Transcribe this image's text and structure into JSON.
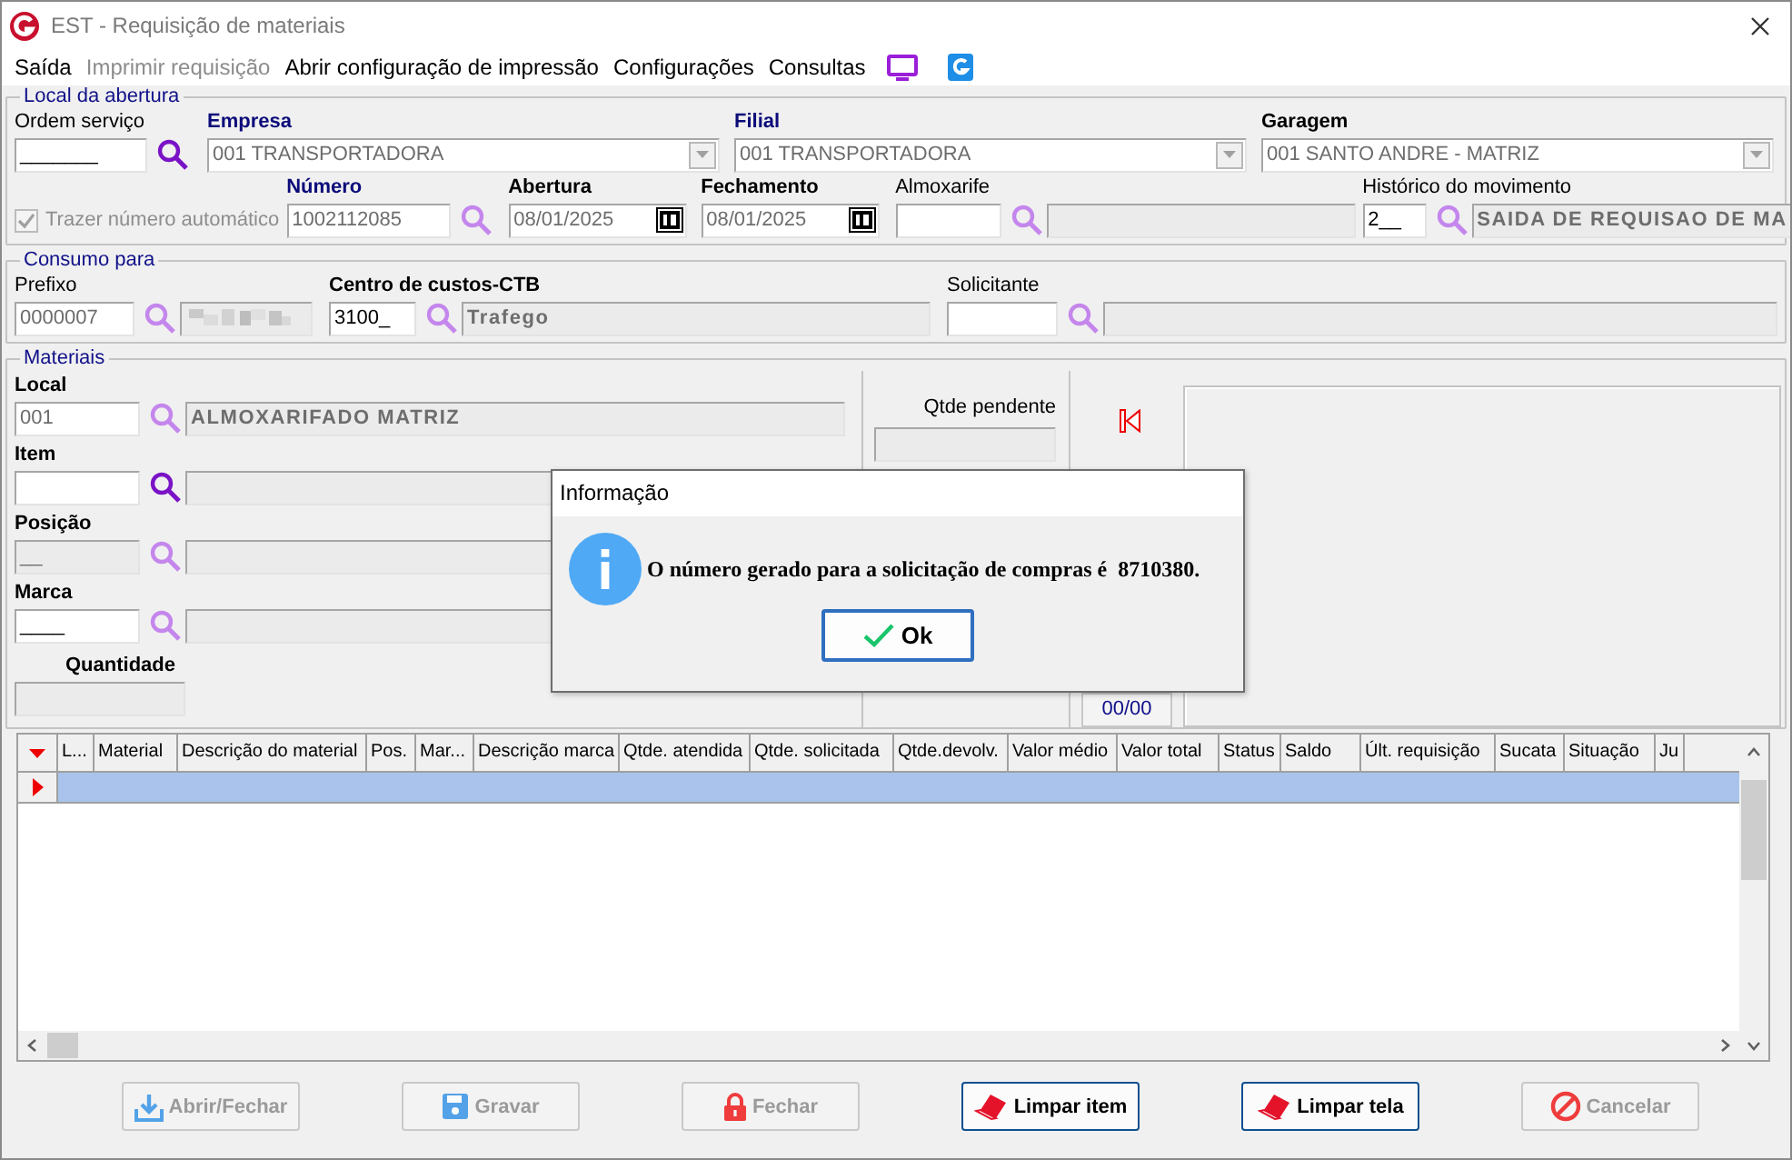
{
  "window": {
    "title": "EST - Requisição de materiais"
  },
  "menu": [
    {
      "label": "Saída",
      "disabled": false
    },
    {
      "label": "Imprimir requisição",
      "disabled": true
    },
    {
      "label": "Abrir configuração de impressão",
      "disabled": false
    },
    {
      "label": "Configurações",
      "disabled": false
    },
    {
      "label": "Consultas",
      "disabled": false
    }
  ],
  "groups": [
    {
      "title": "Local da abertura",
      "lines": [
        {
          "fields": [
            {
              "kind": "text",
              "label": "Ordem serviço",
              "required": false,
              "bold": false,
              "value": "_______",
              "readonly": false,
              "disabled": false,
              "lookup": true,
              "lookup_disabled": false
            },
            {
              "kind": "combo",
              "label": "Empresa",
              "required": true,
              "bold": true,
              "value": "001 TRANSPORTADORA",
              "readonly": true,
              "disabled": false
            },
            {
              "kind": "combo",
              "label": "Filial",
              "required": true,
              "bold": true,
              "value": "001 TRANSPORTADORA",
              "readonly": true,
              "disabled": false
            },
            {
              "kind": "combo",
              "label": "Garagem",
              "required": false,
              "bold": true,
              "value": "001 SANTO ANDRE - MATRIZ",
              "readonly": true,
              "disabled": false
            }
          ]
        },
        {
          "fields": [
            {
              "kind": "checkbox",
              "label": "Trazer número automático",
              "checked": true,
              "disabled": true
            },
            {
              "kind": "text",
              "label": "Número",
              "required": true,
              "bold": true,
              "value": "1002112085",
              "readonly": true,
              "disabled": false,
              "lookup": true,
              "lookup_disabled": true
            },
            {
              "kind": "date",
              "label": "Abertura",
              "required": false,
              "bold": true,
              "value": "08/01/2025",
              "readonly": true,
              "disabled": false
            },
            {
              "kind": "date",
              "label": "Fechamento",
              "required": false,
              "bold": true,
              "value": "08/01/2025",
              "readonly": true,
              "disabled": false
            },
            {
              "kind": "text",
              "label": "Almoxarife",
              "required": false,
              "bold": false,
              "disabled": false,
              "lookup": true,
              "lookup_disabled": true,
              "has_detail": true
            },
            {
              "kind": "text",
              "label": "Histórico do movimento",
              "required": false,
              "bold": false,
              "value": "2__",
              "readonly": false,
              "disabled": false,
              "lookup": true,
              "lookup_disabled": true,
              "has_detail": true,
              "detail": "SAIDA DE REQUISAO DE MA"
            }
          ]
        }
      ]
    },
    {
      "title": "Consumo para",
      "lines": [
        {
          "fields": [
            {
              "kind": "text",
              "label": "Prefixo",
              "required": false,
              "bold": false,
              "value": "0000007",
              "readonly": true,
              "disabled": false,
              "lookup": true,
              "lookup_disabled": true,
              "has_detail": true,
              "detail_redacted": true
            },
            {
              "kind": "text",
              "label": "Centro de custos-CTB",
              "required": false,
              "bold": true,
              "value": "3100_",
              "readonly": false,
              "disabled": false,
              "lookup": true,
              "lookup_disabled": true,
              "has_detail": true,
              "detail": "Trafego"
            },
            {
              "kind": "text",
              "label": "Solicitante",
              "required": false,
              "bold": false,
              "disabled": false,
              "lookup": true,
              "lookup_disabled": true,
              "has_detail": true
            }
          ]
        }
      ]
    },
    {
      "title": "Materiais",
      "lines": [
        {
          "fields": [
            {
              "kind": "text",
              "label": "Local",
              "required": false,
              "bold": true,
              "value": "001",
              "readonly": true,
              "disabled": false,
              "lookup": true,
              "lookup_disabled": true,
              "has_detail": true,
              "detail": "ALMOXARIFADO MATRIZ"
            }
          ]
        },
        {
          "fields": [
            {
              "kind": "text",
              "label": "Item",
              "required": false,
              "bold": true,
              "disabled": false,
              "lookup": true,
              "lookup_disabled": false,
              "has_detail": true
            }
          ]
        },
        {
          "fields": [
            {
              "kind": "text",
              "label": "Posição",
              "required": false,
              "bold": true,
              "value": "__",
              "disabled": true,
              "lookup": true,
              "lookup_disabled": true,
              "has_detail": true
            }
          ]
        },
        {
          "fields": [
            {
              "kind": "text",
              "label": "Marca",
              "required": false,
              "bold": true,
              "value": "____",
              "readonly": false,
              "disabled": false,
              "lookup": true,
              "lookup_disabled": true,
              "has_detail": true
            }
          ]
        },
        {
          "fields": [
            {
              "kind": "text",
              "label": "Quantidade",
              "required": false,
              "bold": true,
              "disabled": true
            }
          ]
        }
      ],
      "pending": {
        "label": "Qtde pendente"
      },
      "page": "00/00"
    }
  ],
  "grid": {
    "columns": [
      "L...",
      "Material",
      "Descrição do material",
      "Pos.",
      "Mar...",
      "Descrição marca",
      "Qtde. atendida",
      "Qtde. solicitada",
      "Qtde.devolv.",
      "Valor médio",
      "Valor total",
      "Status",
      "Saldo",
      "Últ. requisição",
      "Sucata",
      "Situação",
      "Ju"
    ],
    "rows": [
      {
        "selected": true
      }
    ]
  },
  "dialog": {
    "title": "Informação",
    "message": "O número gerado para a solicitação de compras é  8710380.",
    "button": "Ok"
  },
  "buttons": [
    {
      "label": "Abrir/Fechar",
      "disabled": true
    },
    {
      "label": "Gravar",
      "disabled": true
    },
    {
      "label": "Fechar",
      "disabled": true
    },
    {
      "label": "Limpar item",
      "disabled": false
    },
    {
      "label": "Limpar tela",
      "disabled": false
    },
    {
      "label": "Cancelar",
      "disabled": true
    }
  ]
}
